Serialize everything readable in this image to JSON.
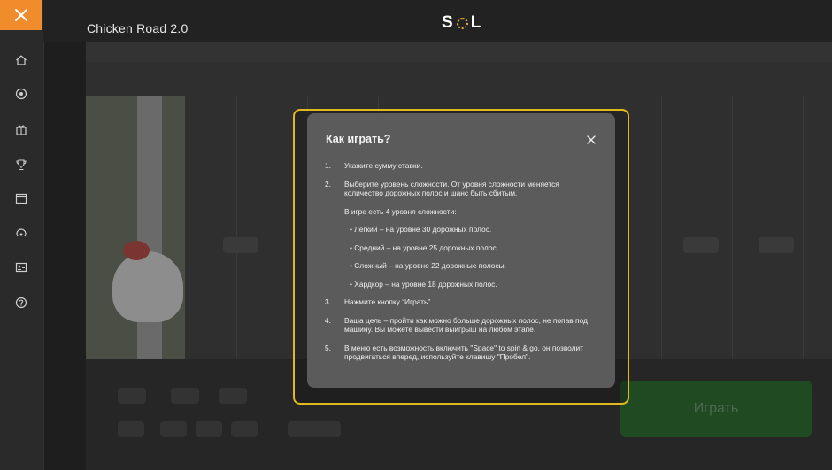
{
  "header": {
    "game_title": "Chicken Road 2.0",
    "logo_left": "S",
    "logo_right": "L"
  },
  "sidebar": {
    "items": [
      {
        "icon": "home-icon"
      },
      {
        "icon": "soccer-ball-icon"
      },
      {
        "icon": "gift-icon"
      },
      {
        "icon": "trophy-icon"
      },
      {
        "icon": "calendar-icon"
      },
      {
        "icon": "live-icon"
      },
      {
        "icon": "id-card-icon"
      },
      {
        "icon": "help-icon"
      }
    ]
  },
  "modal": {
    "title": "Как играть?",
    "steps": [
      {
        "num": "1.",
        "text": "Укажите сумму ставки."
      },
      {
        "num": "2.",
        "text": "Выберите уровень сложности. От уровня сложности меняется количество дорожных полос и шанс быть сбитым."
      }
    ],
    "levels_intro": "В игре есть 4 уровня сложности:",
    "levels": [
      "• Легкий – на уровне 30 дорожных полос.",
      "• Средний – на уровне 25 дорожных полос.",
      "• Сложный – на уровне 22 дорожные полосы.",
      "• Хардкор – на уровне 18 дорожных полос."
    ],
    "steps_after": [
      {
        "num": "3.",
        "text": "Нажмите кнопку “Играть”."
      },
      {
        "num": "4.",
        "text": "Ваша цель – пройти как можно больше дорожных полос, не попав под машину. Вы можете вывести выигрыш на любом этапе."
      },
      {
        "num": "5.",
        "text": "В меню есть возможность включить \"Space\" to spin & go, он позволит продвигаться вперед, используйте клавишу \"Пробел\"."
      }
    ]
  },
  "controls": {
    "play_label": "Играть"
  },
  "colors": {
    "accent": "#f08c2c",
    "frame": "#e2b820",
    "modal_bg": "#5b5b5b"
  }
}
